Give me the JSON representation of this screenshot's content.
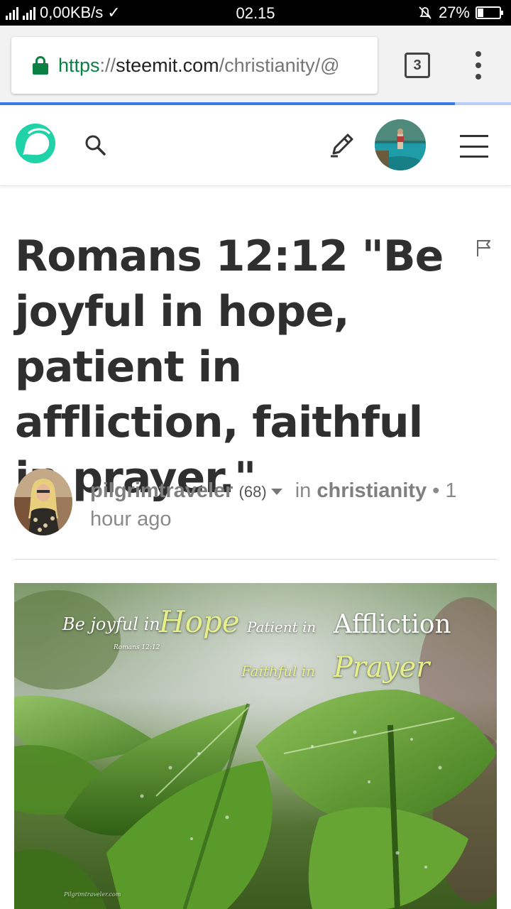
{
  "status_bar": {
    "network_speed": "0,00KB/s",
    "time": "02.15",
    "battery": "27%",
    "battery_level": 0.27
  },
  "browser": {
    "url_scheme": "https",
    "url_sep": "://",
    "url_host": "steemit.com",
    "url_path": "/christianity/@",
    "tab_count": "3",
    "load_progress": 0.89
  },
  "header": {
    "icons": [
      "steemit-logo-icon",
      "search-icon",
      "pen-icon",
      "user-avatar",
      "hamburger-menu-icon"
    ]
  },
  "post": {
    "title": "Romans 12:12 \"Be joyful in hope, patient in affliction, faithful in prayer.\"",
    "author": "pilgrimtraveler",
    "reputation": "(68)",
    "in_label": "in",
    "category": "christianity",
    "separator": "•",
    "time_ago": "1 hour ago"
  },
  "image_overlay": {
    "be_joyful_in": "Be joyful in",
    "hope": "Hope",
    "patient_in": "Patient in",
    "affliction": "Affliction",
    "reference": "Romans 12:12",
    "faithful_in": "Faithful in",
    "prayer": "Prayer",
    "watermark": "Pilgrimtraveler.com"
  },
  "colors": {
    "secure_green": "#0b8043",
    "steemit_teal": "#1fd2a8",
    "progress_blue": "#3b78e7",
    "title_text": "#2f2f2f"
  }
}
